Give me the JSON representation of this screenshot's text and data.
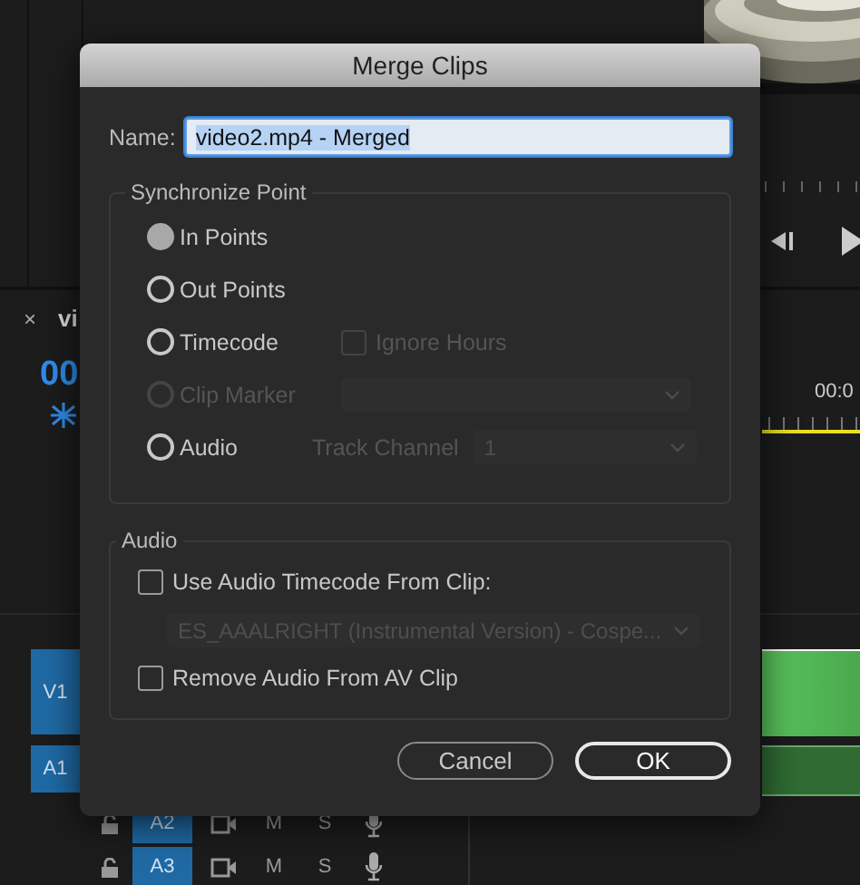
{
  "background": {
    "panel_tab": {
      "close": "×",
      "title": "vi"
    },
    "timecode": "00",
    "ruler_time": "00:0",
    "tracks": [
      {
        "label": "V1"
      },
      {
        "label": "A1"
      }
    ],
    "track_rows": [
      {
        "label": "A2",
        "mute": "M",
        "solo": "S"
      },
      {
        "label": "A3",
        "mute": "M",
        "solo": "S"
      }
    ]
  },
  "dialog": {
    "title": "Merge Clips",
    "name_label": "Name:",
    "name_value": "video2.mp4 - Merged",
    "sync_group": {
      "title": "Synchronize Point",
      "options": [
        {
          "label": "In Points",
          "selected": true,
          "disabled": false
        },
        {
          "label": "Out Points",
          "selected": false,
          "disabled": false
        },
        {
          "label": "Timecode",
          "selected": false,
          "disabled": false,
          "extra": {
            "kind": "checkbox",
            "label": "Ignore Hours",
            "checked": false,
            "disabled": true
          }
        },
        {
          "label": "Clip Marker",
          "selected": false,
          "disabled": true,
          "extra": {
            "kind": "dropdown",
            "disabled": true
          }
        },
        {
          "label": "Audio",
          "selected": false,
          "disabled": false,
          "extra": {
            "kind": "labeled_dropdown",
            "label": "Track Channel",
            "value": "1",
            "disabled": true
          }
        }
      ]
    },
    "audio_group": {
      "title": "Audio",
      "items": [
        {
          "kind": "checkbox",
          "label": "Use Audio Timecode From Clip:",
          "checked": false,
          "disabled": false
        },
        {
          "kind": "dropdown",
          "value": "ES_AAALRIGHT (Instrumental Version) - Cospe...",
          "disabled": true
        },
        {
          "kind": "checkbox",
          "label": "Remove Audio From AV Clip",
          "checked": false,
          "disabled": false
        }
      ]
    },
    "buttons": [
      {
        "label": "Cancel",
        "default": false
      },
      {
        "label": "OK",
        "default": true
      }
    ]
  }
}
